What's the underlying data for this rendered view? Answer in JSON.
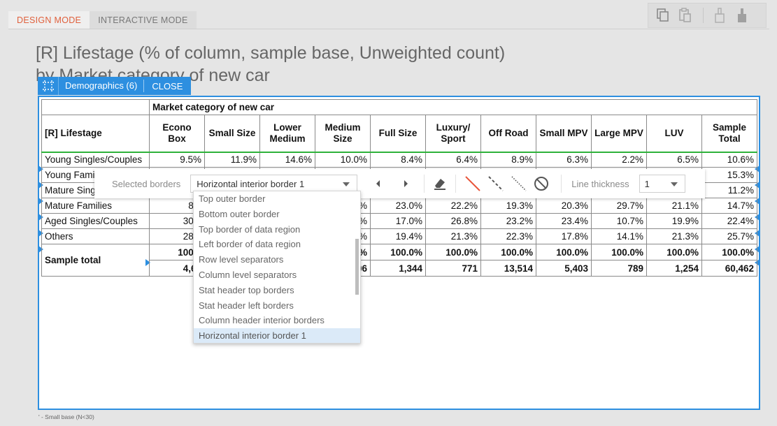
{
  "modes": {
    "design": "DESIGN MODE",
    "interactive": "INTERACTIVE MODE"
  },
  "toolbar_icons": [
    "copy-icon",
    "paste-icon",
    "brush-outline-icon",
    "brush-filled-icon"
  ],
  "title": {
    "line1": "[R] Lifestage (% of column, sample base, Unweighted count)",
    "line2": "by Market category of new car"
  },
  "selection": {
    "label": "Demographics (6)",
    "close": "CLOSE"
  },
  "table": {
    "banner": "Market category of new car",
    "row_header": "[R] Lifestage",
    "columns": [
      "Econo Box",
      "Small Size",
      "Lower Medium",
      "Medium Size",
      "Full Size",
      "Luxury/ Sport",
      "Off Road",
      "Small MPV",
      "Large MPV",
      "LUV",
      "Sample Total"
    ],
    "rows": [
      {
        "label": "Young Singles/Couples",
        "cells": [
          "9.5%",
          "11.9%",
          "14.6%",
          "10.0%",
          "8.4%",
          "6.4%",
          "8.9%",
          "6.3%",
          "2.2%",
          "6.5%",
          "10.6%"
        ]
      },
      {
        "label": "Young Families",
        "cells": [
          "",
          "",
          "",
          "",
          "",
          "",
          "",
          "",
          "",
          "",
          "15.3%"
        ]
      },
      {
        "label": "Mature Singles/Couples",
        "cells": [
          "",
          "",
          "",
          "",
          "",
          "",
          "",
          "",
          "",
          "",
          "11.2%"
        ]
      },
      {
        "label": "Mature Families",
        "cells": [
          "8.8",
          "",
          "",
          "%",
          "23.0%",
          "22.2%",
          "19.3%",
          "20.3%",
          "29.7%",
          "21.1%",
          "14.7%"
        ]
      },
      {
        "label": "Aged Singles/Couples",
        "cells": [
          "30.8",
          "",
          "",
          "%",
          "17.0%",
          "26.8%",
          "23.2%",
          "23.4%",
          "10.7%",
          "19.9%",
          "22.4%"
        ]
      },
      {
        "label": "Others",
        "cells": [
          "28.7",
          "",
          "",
          "%",
          "19.4%",
          "21.3%",
          "22.3%",
          "17.8%",
          "14.1%",
          "21.3%",
          "25.7%"
        ]
      }
    ],
    "total_label": "Sample total",
    "total_pct": [
      "100.0",
      "",
      "",
      "%",
      "100.0%",
      "100.0%",
      "100.0%",
      "100.0%",
      "100.0%",
      "100.0%",
      "100.0%"
    ],
    "total_count": [
      "4,63",
      "",
      "",
      "06",
      "1,344",
      "771",
      "13,514",
      "5,403",
      "789",
      "1,254",
      "60,462"
    ]
  },
  "border_toolbar": {
    "selected_label": "Selected borders",
    "selected_value": "Horizontal interior border 1",
    "thickness_label": "Line thickness",
    "thickness_value": "1"
  },
  "dropdown": {
    "items": [
      "Top outer border",
      "Bottom outer border",
      "Top border of data region",
      "Left border of data region",
      "Row level separators",
      "Column level separators",
      "Stat header top borders",
      "Stat header left borders",
      "Column header interior borders",
      "Horizontal interior border 1"
    ],
    "selected_index": 9
  },
  "footnote": "' - Small base (N<30)",
  "colors": {
    "accent": "#2d8fe0",
    "active_tab": "#e0603c",
    "data_region_border": "#2eb23a",
    "line_color": "#e8553a"
  }
}
